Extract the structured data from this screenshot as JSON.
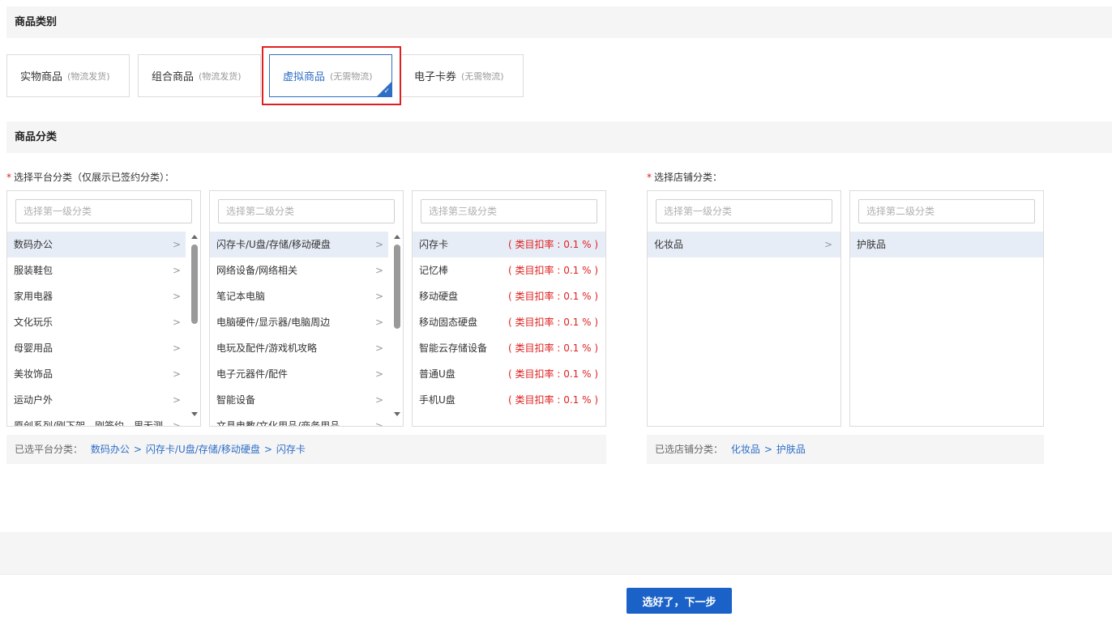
{
  "category_section": {
    "title": "商品类别",
    "types": [
      {
        "name": "实物商品",
        "note": "(物流发货)"
      },
      {
        "name": "组合商品",
        "note": "(物流发货)"
      },
      {
        "name": "虚拟商品",
        "note": "(无需物流)",
        "selected": true
      },
      {
        "name": "电子卡券",
        "note": "(无需物流)"
      }
    ]
  },
  "classification_section": {
    "title": "商品分类",
    "platform": {
      "label": "选择平台分类（仅展示已签约分类）：",
      "level1": {
        "placeholder": "选择第一级分类",
        "items": [
          "数码办公",
          "服装鞋包",
          "家用电器",
          "文化玩乐",
          "母婴用品",
          "美妆饰品",
          "运动户外",
          "原创系列/刚下架，刚签约，里无测"
        ],
        "selected_index": 0
      },
      "level2": {
        "placeholder": "选择第二级分类",
        "items": [
          "闪存卡/U盘/存储/移动硬盘",
          "网络设备/网络相关",
          "笔记本电脑",
          "电脑硬件/显示器/电脑周边",
          "电玩及配件/游戏机攻略",
          "电子元器件/配件",
          "智能设备",
          "文具电教/文化用品/商务用品"
        ],
        "selected_index": 0
      },
      "level3": {
        "placeholder": "选择第三级分类",
        "items": [
          {
            "name": "闪存卡",
            "rate": "( 类目扣率 : 0.1 % )"
          },
          {
            "name": "记忆棒",
            "rate": "( 类目扣率 : 0.1 % )"
          },
          {
            "name": "移动硬盘",
            "rate": "( 类目扣率 : 0.1 % )"
          },
          {
            "name": "移动固态硬盘",
            "rate": "( 类目扣率 : 0.1 % )"
          },
          {
            "name": "智能云存储设备",
            "rate": "( 类目扣率 : 0.1 % )"
          },
          {
            "name": "普通U盘",
            "rate": "( 类目扣率 : 0.1 % )"
          },
          {
            "name": "手机U盘",
            "rate": "( 类目扣率 : 0.1 % )"
          }
        ],
        "selected_index": 0
      },
      "selected_path_label": "已选平台分类：",
      "selected_path": [
        "数码办公",
        "闪存卡/U盘/存储/移动硬盘",
        "闪存卡"
      ]
    },
    "store": {
      "label": "选择店铺分类：",
      "level1": {
        "placeholder": "选择第一级分类",
        "items": [
          "化妆品"
        ],
        "selected_index": 0
      },
      "level2": {
        "placeholder": "选择第二级分类",
        "items": [
          "护肤品"
        ],
        "selected_index": 0
      },
      "selected_path_label": "已选店铺分类：",
      "selected_path": [
        "化妆品",
        "护肤品"
      ]
    }
  },
  "footer": {
    "next_button": "选好了，下一步"
  },
  "icons": {
    "arrow": "chevron-right-icon",
    "check": "check-icon"
  },
  "colors": {
    "accent": "#2f6ec5",
    "button": "#1b62c8",
    "rate": "#e02020",
    "highlight": "#e02020"
  }
}
